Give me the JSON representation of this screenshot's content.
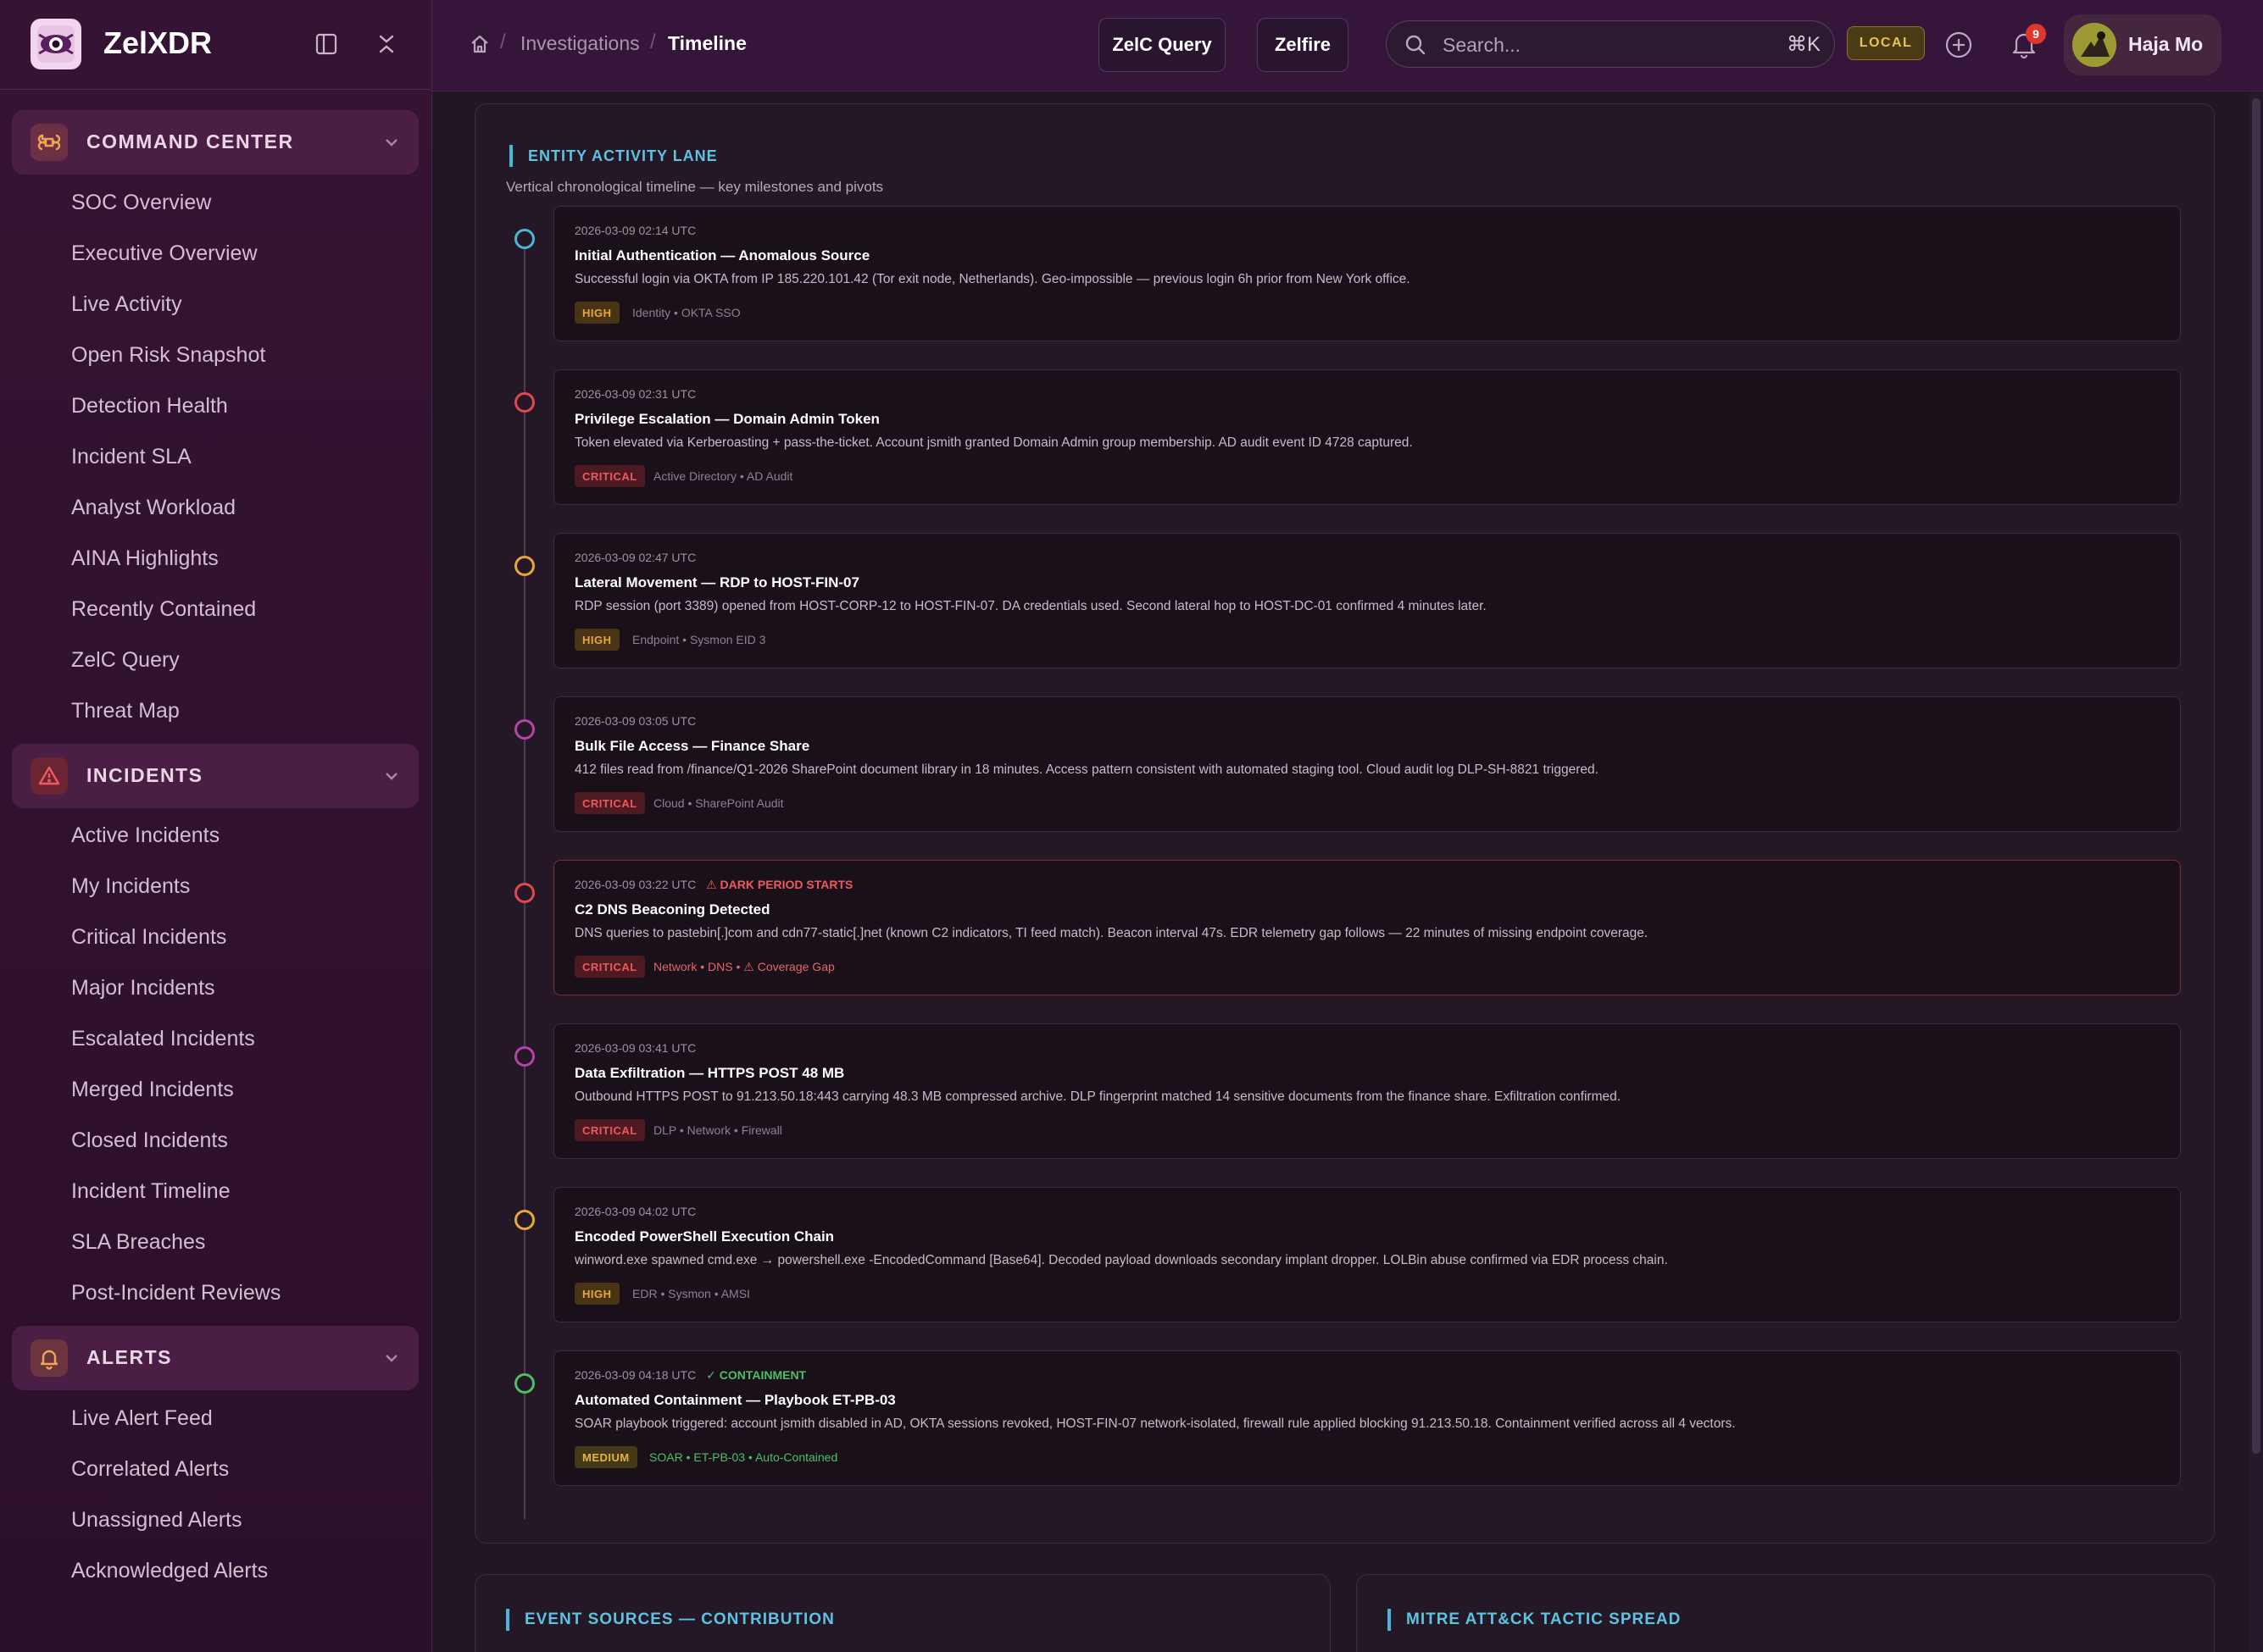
{
  "brand": {
    "name": "ZelXDR"
  },
  "sidebar": {
    "sections": [
      {
        "label": "COMMAND CENTER",
        "icon": "command-icon",
        "items": [
          "SOC Overview",
          "Executive Overview",
          "Live Activity",
          "Open Risk Snapshot",
          "Detection Health",
          "Incident SLA",
          "Analyst Workload",
          "AINA Highlights",
          "Recently Contained",
          "ZelC Query",
          "Threat Map"
        ]
      },
      {
        "label": "INCIDENTS",
        "icon": "warning-icon",
        "items": [
          "Active Incidents",
          "My Incidents",
          "Critical Incidents",
          "Major Incidents",
          "Escalated Incidents",
          "Merged Incidents",
          "Closed Incidents",
          "Incident Timeline",
          "SLA Breaches",
          "Post-Incident Reviews"
        ]
      },
      {
        "label": "ALERTS",
        "icon": "bell-icon",
        "items": [
          "Live Alert Feed",
          "Correlated Alerts",
          "Unassigned Alerts",
          "Acknowledged Alerts"
        ]
      }
    ]
  },
  "topbar": {
    "breadcrumb": [
      "Investigations",
      "Timeline"
    ],
    "buttons": {
      "zelc_query": "ZelC Query",
      "zelfire": "Zelfire"
    },
    "search": {
      "placeholder": "Search...",
      "shortcut": "⌘K"
    },
    "env_badge": "LOCAL",
    "notifications_count": "9",
    "user": {
      "name": "Haja Mo"
    }
  },
  "timeline": {
    "title": "ENTITY ACTIVITY LANE",
    "subtitle": "Vertical chronological timeline — key milestones and pivots",
    "events": [
      {
        "time": "2026-03-09  02:14 UTC",
        "flag": "",
        "title": "Initial Authentication — Anomalous Source",
        "desc": "Successful login via OKTA from IP 185.220.101.42 (Tor exit node, Netherlands). Geo-impossible — previous login 6h prior from New York office.",
        "severity": "HIGH",
        "source": "Identity • OKTA SSO",
        "dot_color": "#4cb6d9"
      },
      {
        "time": "2026-03-09  02:31 UTC",
        "flag": "",
        "title": "Privilege Escalation — Domain Admin Token",
        "desc": "Token elevated via Kerberoasting + pass-the-ticket. Account jsmith granted Domain Admin group membership. AD audit event ID 4728 captured.",
        "severity": "CRITICAL",
        "source": "Active Directory • AD Audit",
        "dot_color": "#e2484d"
      },
      {
        "time": "2026-03-09  02:47 UTC",
        "flag": "",
        "title": "Lateral Movement — RDP to HOST-FIN-07",
        "desc": "RDP session (port 3389) opened from HOST-CORP-12 to HOST-FIN-07. DA credentials used. Second lateral hop to HOST-DC-01 confirmed 4 minutes later.",
        "severity": "HIGH",
        "source": "Endpoint • Sysmon EID 3",
        "dot_color": "#e8a73c"
      },
      {
        "time": "2026-03-09  03:05 UTC",
        "flag": "",
        "title": "Bulk File Access — Finance Share",
        "desc": "412 files read from /finance/Q1-2026 SharePoint document library in 18 minutes. Access pattern consistent with automated staging tool. Cloud audit log DLP-SH-8821 triggered.",
        "severity": "CRITICAL",
        "source": "Cloud • SharePoint Audit",
        "dot_color": "#b444a8"
      },
      {
        "time": "2026-03-09  03:22 UTC",
        "flag": "⚠ DARK PERIOD STARTS",
        "title": "C2 DNS Beaconing Detected",
        "desc": "DNS queries to pastebin[.]com and cdn77-static[.]net (known C2 indicators, TI feed match). Beacon interval 47s. EDR telemetry gap follows — 22 minutes of missing endpoint coverage.",
        "severity": "CRITICAL",
        "source": "Network • DNS • ⚠ Coverage Gap",
        "dot_color": "#e2484d"
      },
      {
        "time": "2026-03-09  03:41 UTC",
        "flag": "",
        "title": "Data Exfiltration — HTTPS POST 48 MB",
        "desc": "Outbound HTTPS POST to 91.213.50.18:443 carrying 48.3 MB compressed archive. DLP fingerprint matched 14 sensitive documents from the finance share. Exfiltration confirmed.",
        "severity": "CRITICAL",
        "source": "DLP • Network • Firewall",
        "dot_color": "#b444a8"
      },
      {
        "time": "2026-03-09  04:02 UTC",
        "flag": "",
        "title": "Encoded PowerShell Execution Chain",
        "desc": "winword.exe spawned cmd.exe → powershell.exe -EncodedCommand [Base64]. Decoded payload downloads secondary implant dropper. LOLBin abuse confirmed via EDR process chain.",
        "severity": "HIGH",
        "source": "EDR • Sysmon • AMSI",
        "dot_color": "#e8a73c"
      },
      {
        "time": "2026-03-09  04:18 UTC",
        "flag": "✓ CONTAINMENT",
        "title": "Automated Containment — Playbook ET-PB-03",
        "desc": "SOAR playbook triggered: account jsmith disabled in AD, OKTA sessions revoked, HOST-FIN-07 network-isolated, firewall rule applied blocking 91.213.50.18. Containment verified across all 4 vectors.",
        "severity": "MEDIUM",
        "source": "SOAR • ET-PB-03 • Auto-Contained",
        "dot_color": "#4fbf64"
      }
    ]
  },
  "lower_cards": {
    "event_sources": "EVENT SOURCES — CONTRIBUTION",
    "mitre": "MITRE ATT&CK TACTIC SPREAD"
  },
  "colors": {
    "accent": "#4cb6d9",
    "critical": "#ec5a5e",
    "high": "#e8a73c",
    "medium": "#e3b345",
    "containment": "#4fbf64"
  }
}
